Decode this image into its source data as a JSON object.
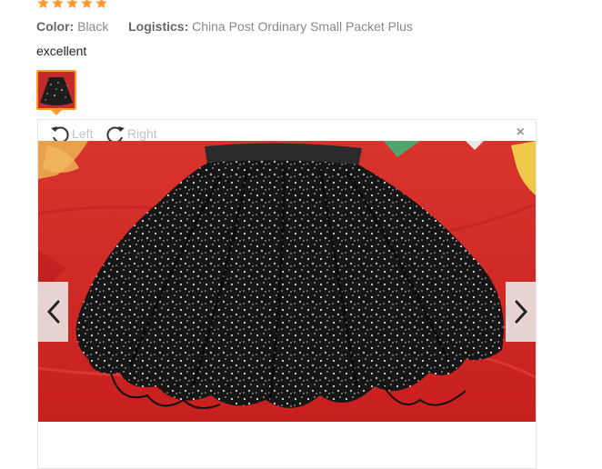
{
  "rating": {
    "stars": 5,
    "max": 5,
    "color": "#ff9a2e"
  },
  "review": {
    "color_label": "Color:",
    "color_value": "Black",
    "logistics_label": "Logistics:",
    "logistics_value": "China Post Ordinary Small Packet Plus",
    "text": "excellent"
  },
  "viewer": {
    "rotate_left_label": "Left",
    "rotate_right_label": "Right",
    "close_symbol": "×",
    "image_alt": "Black glitter tulle skirt on red fabric"
  },
  "colors": {
    "accent": "#ff9a2e",
    "muted": "#c2c2c2"
  }
}
